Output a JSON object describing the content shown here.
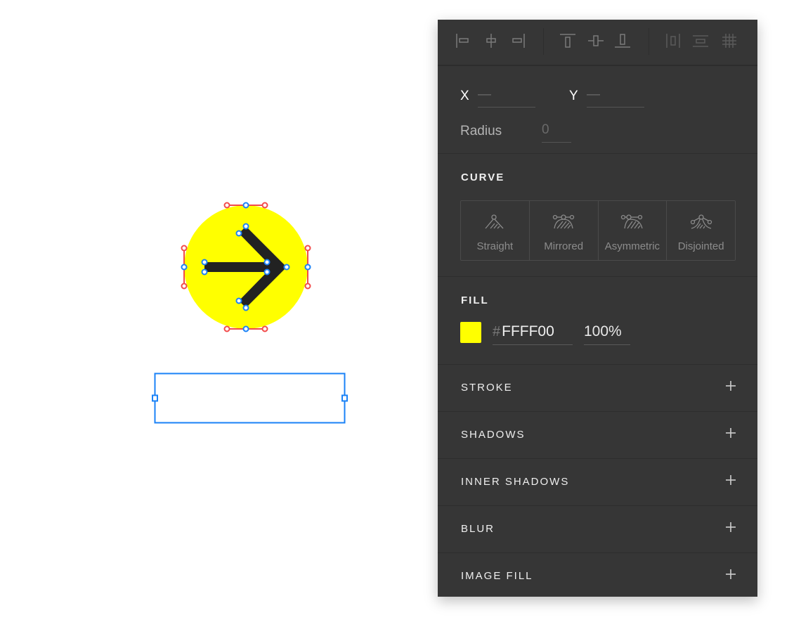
{
  "canvas": {
    "circle": {
      "fill": "#FFFF00",
      "arrow_color": "#222222"
    },
    "selection_color": "#1a82f7",
    "handle_color": "#f23a3a"
  },
  "toolbar": {
    "icons": [
      {
        "name": "align-left-icon"
      },
      {
        "name": "align-horizontal-center-icon"
      },
      {
        "name": "align-right-icon"
      },
      {
        "name": "align-top-icon"
      },
      {
        "name": "align-vertical-center-icon"
      },
      {
        "name": "align-bottom-icon"
      },
      {
        "name": "distribute-horizontal-icon"
      },
      {
        "name": "distribute-vertical-icon"
      },
      {
        "name": "grid-icon"
      }
    ]
  },
  "position": {
    "x_label": "X",
    "x_value": "—",
    "y_label": "Y",
    "y_value": "—",
    "radius_label": "Radius",
    "radius_value": "0"
  },
  "curve": {
    "title": "CURVE",
    "options": [
      {
        "label": "Straight"
      },
      {
        "label": "Mirrored"
      },
      {
        "label": "Asymmetric"
      },
      {
        "label": "Disjointed"
      }
    ]
  },
  "fill": {
    "title": "FILL",
    "color": "#FFFF00",
    "hash": "#",
    "hex": "FFFF00",
    "opacity": "100%"
  },
  "sections": [
    {
      "label": "STROKE"
    },
    {
      "label": "SHADOWS"
    },
    {
      "label": "INNER SHADOWS"
    },
    {
      "label": "BLUR"
    },
    {
      "label": "IMAGE FILL"
    }
  ]
}
